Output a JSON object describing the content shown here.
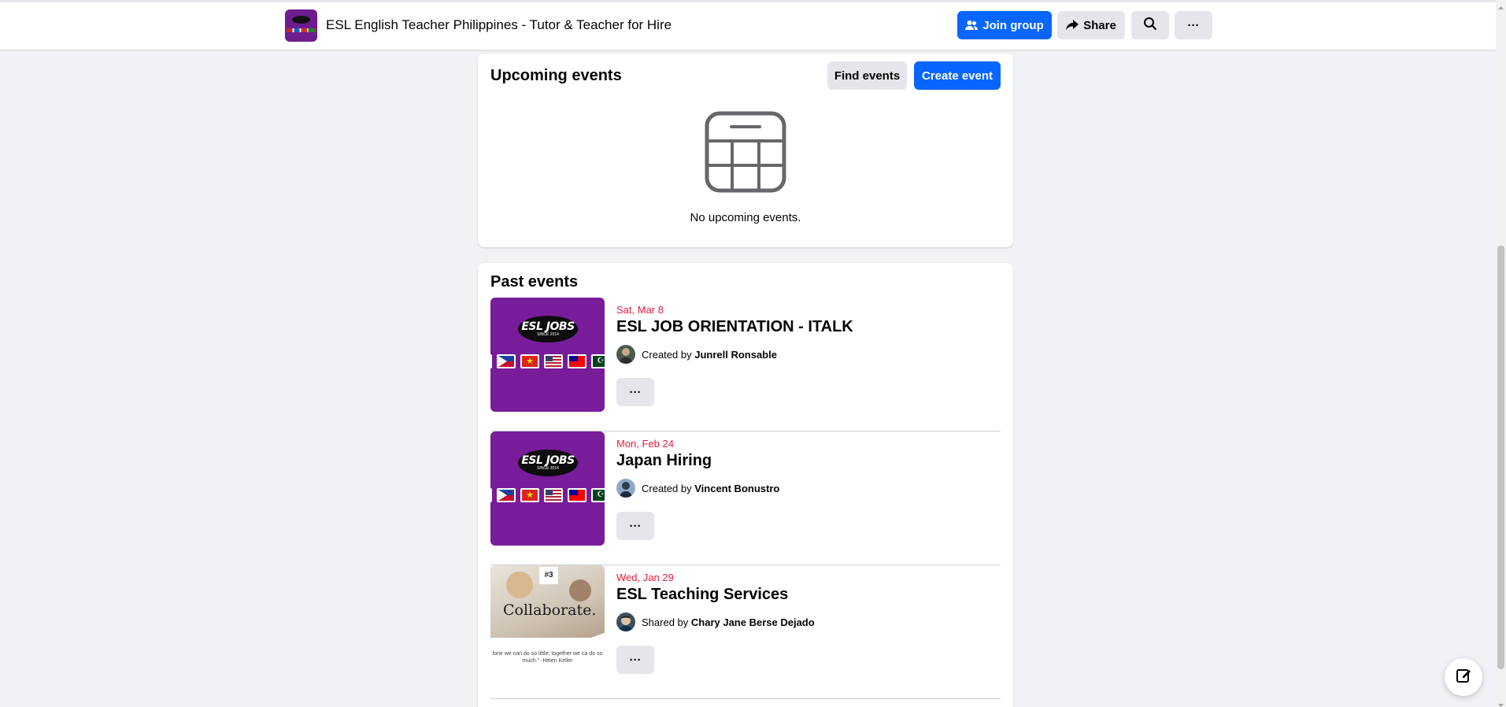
{
  "header": {
    "group_name": "ESL English Teacher Philippines - Tutor & Teacher for Hire",
    "join_label": "Join group",
    "share_label": "Share",
    "search_icon": "search-icon",
    "more_icon": "more-dots-icon",
    "more_label": "···"
  },
  "upcoming": {
    "title": "Upcoming events",
    "find_label": "Find events",
    "create_label": "Create event",
    "empty_icon": "calendar-icon",
    "empty_text": "No upcoming events."
  },
  "past": {
    "title": "Past events",
    "events": [
      {
        "date": "Sat, Mar 8",
        "title": "ESL JOB ORIENTATION - ITALK",
        "by_prefix": "Created by",
        "by_name": "Junrell Ronsable",
        "thumb_logo": "ESL JOBS",
        "thumb_tagline": "SINCE 2014",
        "more_label": "···"
      },
      {
        "date": "Mon, Feb 24",
        "title": "Japan Hiring",
        "by_prefix": "Created by",
        "by_name": "Vincent Bonustro",
        "thumb_logo": "ESL JOBS",
        "thumb_tagline": "SINCE 2014",
        "more_label": "···"
      },
      {
        "date": "Wed, Jan 29",
        "title": "ESL Teaching Services",
        "by_prefix": "Shared by",
        "by_name": "Chary Jane Berse Dejado",
        "thumb_badge": "#3",
        "thumb_caption": "Collaborate.",
        "thumb_quote": "lone we can do so little; together we ca do so much.\" -Helen Keller",
        "more_label": "···"
      }
    ]
  },
  "colors": {
    "primary": "#0866ff",
    "date_red": "#e41e3f",
    "button_gray": "#e4e6eb",
    "page_bg": "#f0f2f5",
    "thumb_purple": "#781c9a"
  },
  "fab_icon": "compose-icon"
}
